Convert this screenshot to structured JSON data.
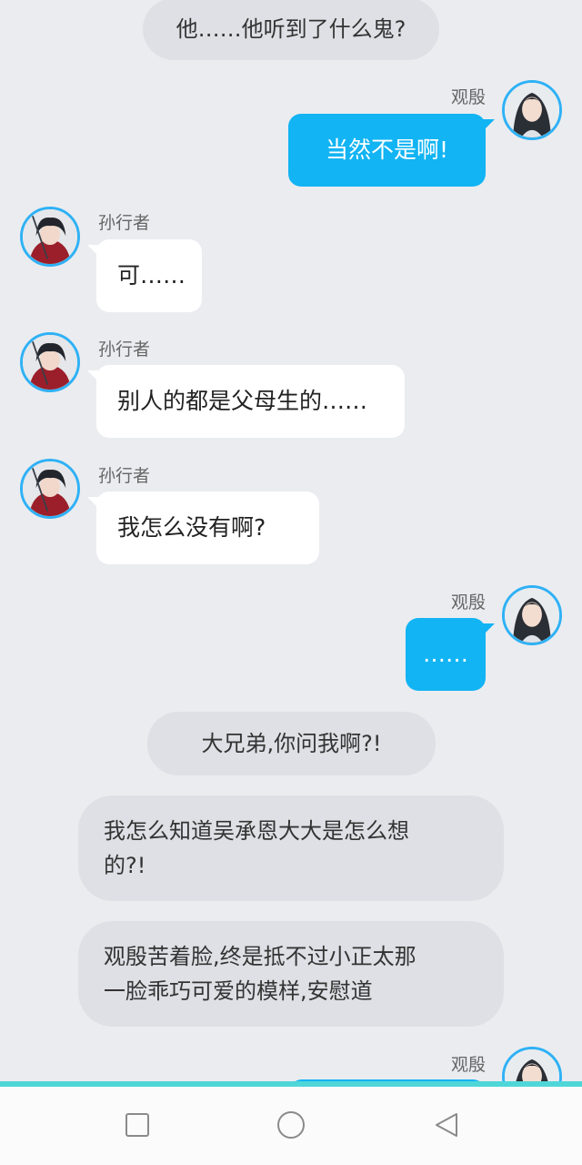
{
  "chat": {
    "messages": [
      {
        "kind": "narration",
        "text": "他……他听到了什么鬼?"
      },
      {
        "kind": "right",
        "sender": "观殷",
        "text": "当然不是啊!"
      },
      {
        "kind": "left",
        "sender": "孙行者",
        "text": "可……"
      },
      {
        "kind": "left",
        "sender": "孙行者",
        "text": "别人的都是父母生的……"
      },
      {
        "kind": "left",
        "sender": "孙行者",
        "text": "我怎么没有啊?"
      },
      {
        "kind": "right",
        "sender": "观殷",
        "text": "……"
      },
      {
        "kind": "narration",
        "text": "大兄弟,你问我啊?!"
      },
      {
        "kind": "narration",
        "lines": [
          "我怎么知道吴承恩大大是怎么想",
          "的?!"
        ]
      },
      {
        "kind": "narration",
        "lines": [
          "观殷苦着脸,终是抵不过小正太那",
          "一脸乖巧可爱的模样,安慰道"
        ]
      },
      {
        "kind": "right",
        "sender": "观殷",
        "text": ""
      }
    ]
  },
  "avatars": {
    "left_character": "dark-haired-boy-red-robe-avatar",
    "right_character": "long-haired-man-avatar"
  },
  "navbar": {
    "icons": [
      "square-icon",
      "circle-icon",
      "back-triangle-icon"
    ]
  },
  "colors": {
    "background": "#ebecf0",
    "narration_bubble": "#dfe0e5",
    "own_bubble": "#12b4f3",
    "other_bubble": "#ffffff",
    "avatar_ring": "#2fb1f5",
    "accent_bar": "#4fd6d8"
  }
}
